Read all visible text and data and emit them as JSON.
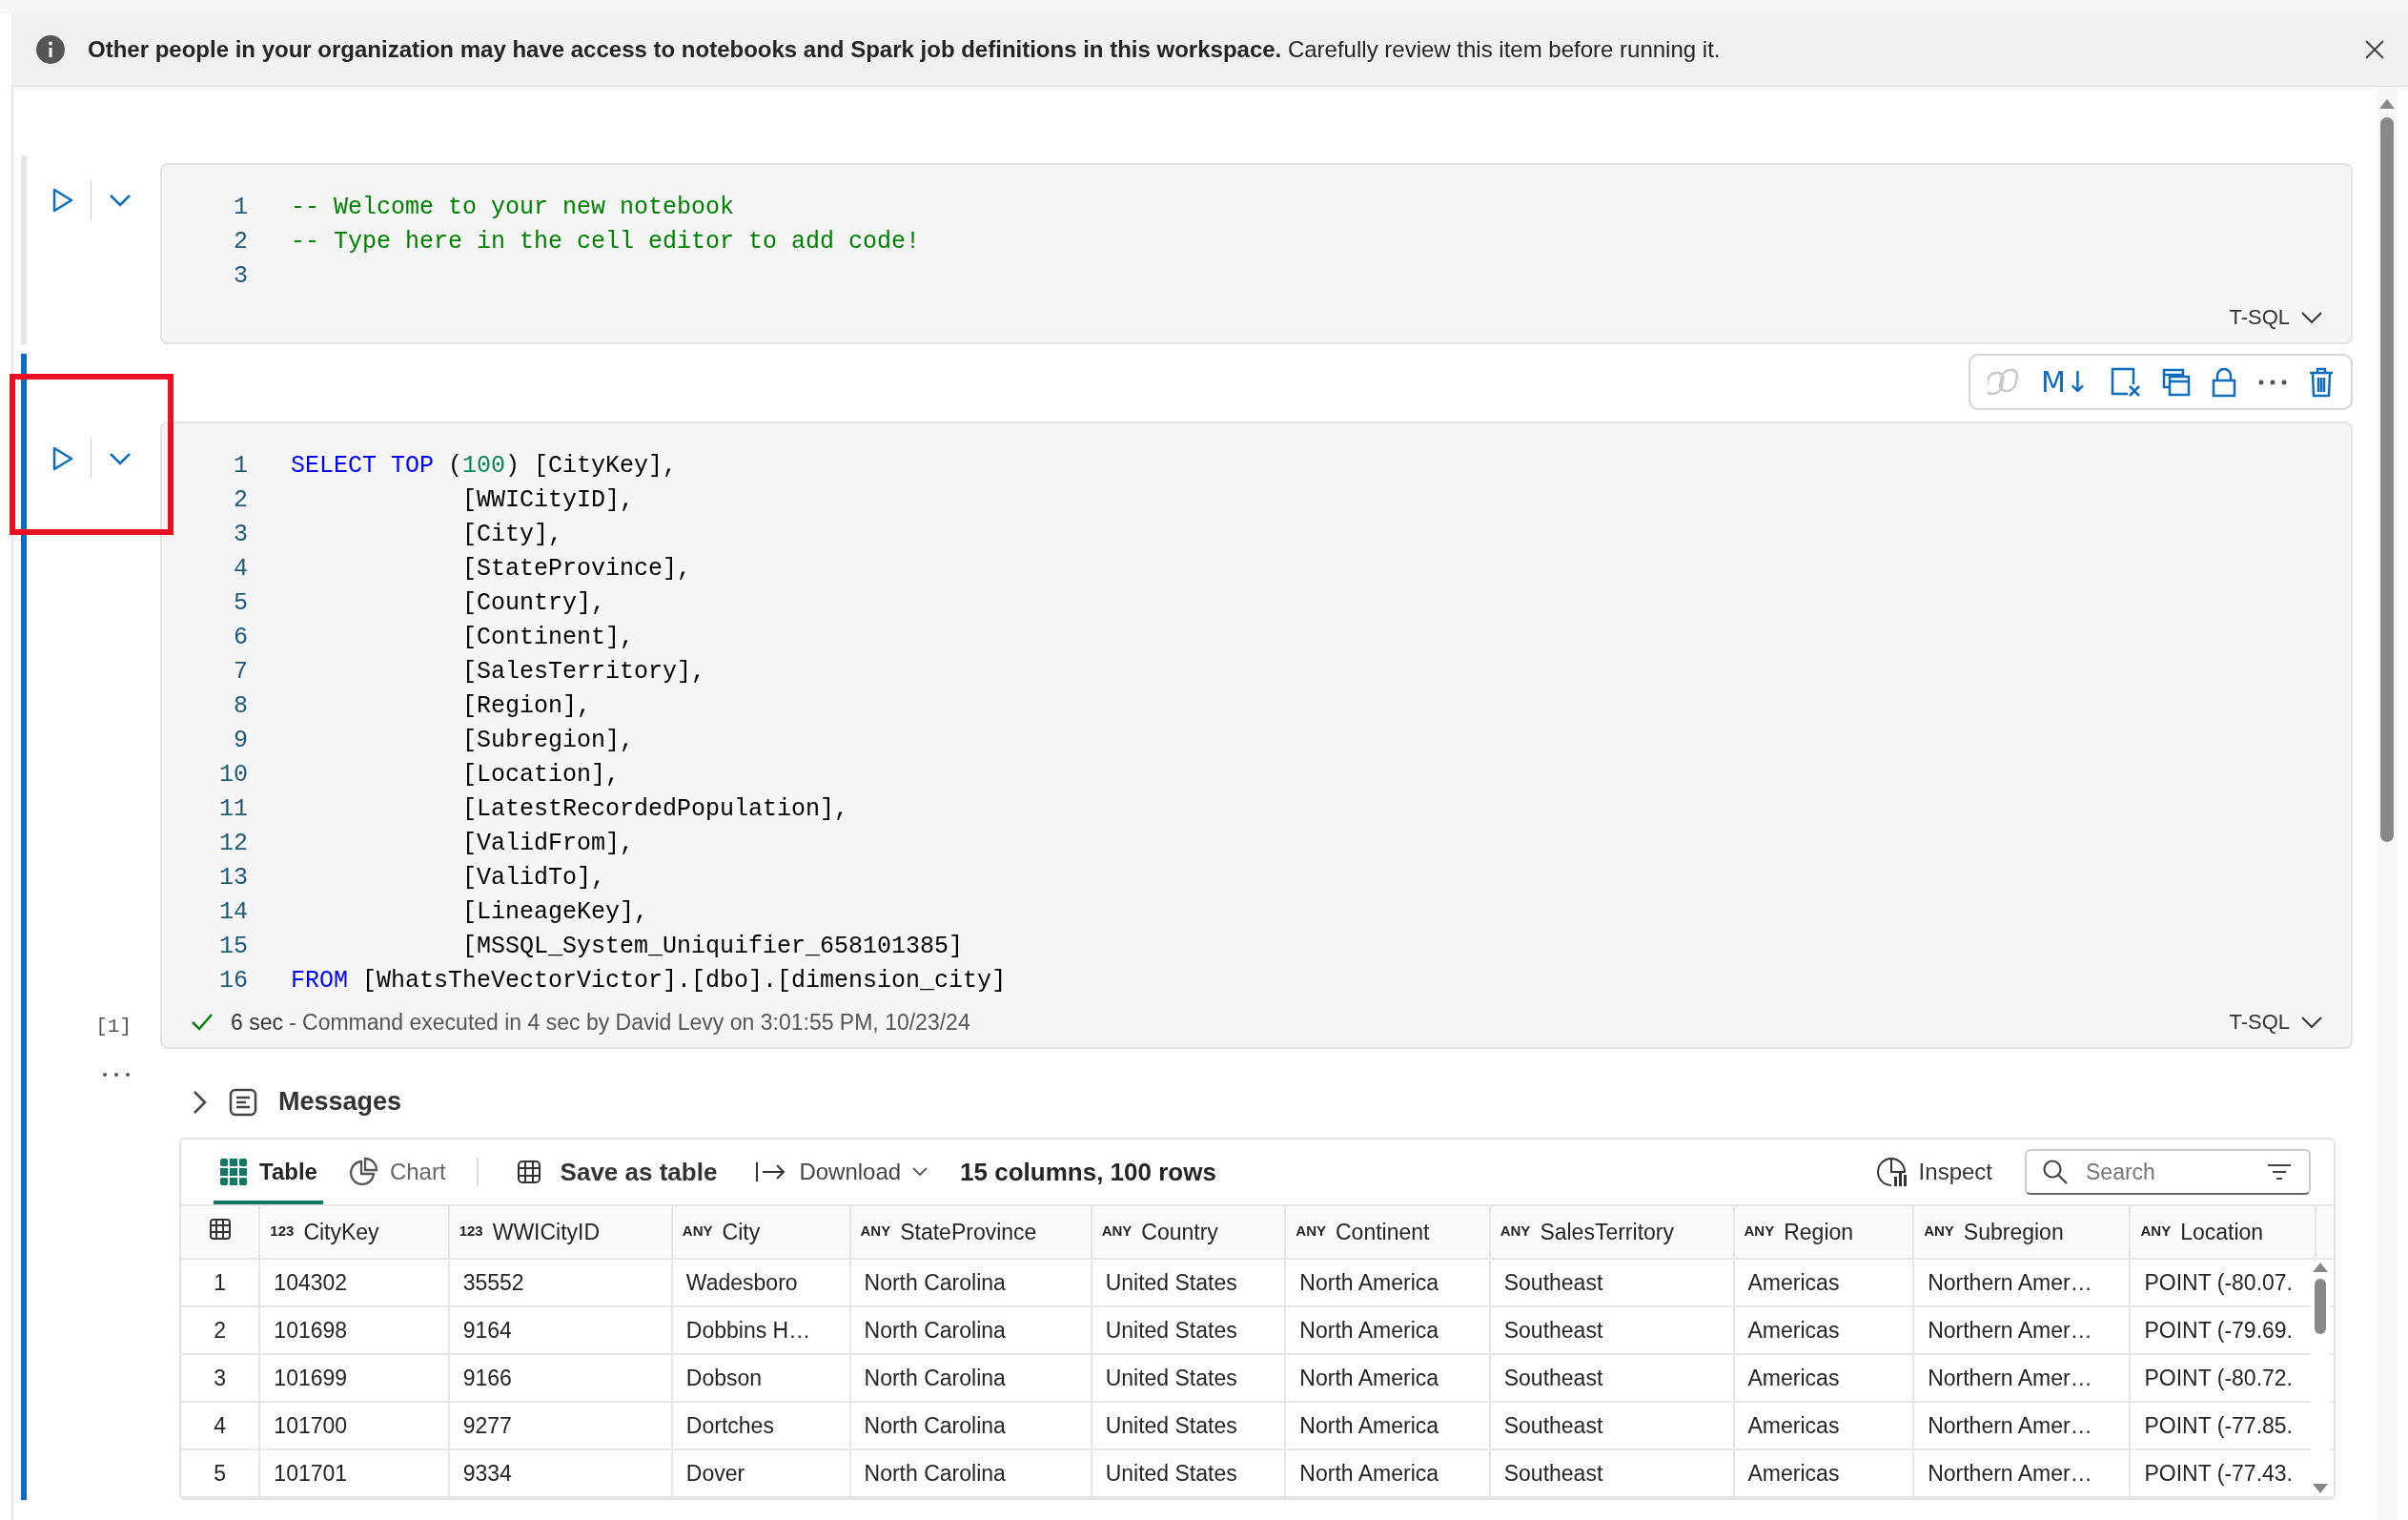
{
  "banner": {
    "bold_text": "Other people in your organization may have access to notebooks and Spark job definitions in this workspace.",
    "text": "Carefully review this item before running it."
  },
  "cells": [
    {
      "selected": false,
      "annotated": false,
      "language": "T-SQL",
      "lines": [
        {
          "number": "1",
          "tokens": [
            {
              "text": "-- Welcome to your new notebook",
              "kind": "comment"
            }
          ]
        },
        {
          "number": "2",
          "tokens": [
            {
              "text": "-- Type here in the cell editor to add code!",
              "kind": "comment"
            }
          ]
        },
        {
          "number": "3"
        }
      ]
    },
    {
      "selected": true,
      "annotated": true,
      "language": "T-SQL",
      "toolbar": {
        "copilot_enabled": false,
        "markdown_label": "M↓"
      },
      "lines": [
        {
          "number": "1",
          "tokens": [
            {
              "text": "SELECT",
              "kind": "keyword"
            },
            {
              "text": " TOP",
              "kind": "keyword"
            },
            {
              "text": " (",
              "kind": "plain"
            },
            {
              "text": "100",
              "kind": "number"
            },
            {
              "text": ") [CityKey],",
              "kind": "plain"
            }
          ]
        },
        {
          "number": "2",
          "tokens": [
            {
              "text": "            [WWICityID],",
              "kind": "plain"
            }
          ]
        },
        {
          "number": "3",
          "tokens": [
            {
              "text": "            [City],",
              "kind": "plain"
            }
          ]
        },
        {
          "number": "4",
          "tokens": [
            {
              "text": "            [StateProvince],",
              "kind": "plain"
            }
          ]
        },
        {
          "number": "5",
          "tokens": [
            {
              "text": "            [Country],",
              "kind": "plain"
            }
          ]
        },
        {
          "number": "6",
          "tokens": [
            {
              "text": "            [Continent],",
              "kind": "plain"
            }
          ]
        },
        {
          "number": "7",
          "tokens": [
            {
              "text": "            [SalesTerritory],",
              "kind": "plain"
            }
          ]
        },
        {
          "number": "8",
          "tokens": [
            {
              "text": "            [Region],",
              "kind": "plain"
            }
          ]
        },
        {
          "number": "9",
          "tokens": [
            {
              "text": "            [Subregion],",
              "kind": "plain"
            }
          ]
        },
        {
          "number": "10",
          "tokens": [
            {
              "text": "            [Location],",
              "kind": "plain"
            }
          ]
        },
        {
          "number": "11",
          "tokens": [
            {
              "text": "            [LatestRecordedPopulation],",
              "kind": "plain"
            }
          ]
        },
        {
          "number": "12",
          "tokens": [
            {
              "text": "            [ValidFrom],",
              "kind": "plain"
            }
          ]
        },
        {
          "number": "13",
          "tokens": [
            {
              "text": "            [ValidTo],",
              "kind": "plain"
            }
          ]
        },
        {
          "number": "14",
          "tokens": [
            {
              "text": "            [LineageKey],",
              "kind": "plain"
            }
          ]
        },
        {
          "number": "15",
          "tokens": [
            {
              "text": "            [MSSQL_System_Uniquifier_658101385]",
              "kind": "plain"
            }
          ]
        },
        {
          "number": "16",
          "tokens": [
            {
              "text": "FROM",
              "kind": "keyword"
            },
            {
              "text": " [WhatsTheVectorVictor].[dbo].[dimension_city]",
              "kind": "plain"
            }
          ]
        }
      ],
      "execution": {
        "count": "[1]",
        "duration": "6 sec",
        "message": "- Command executed in 4 sec by David Levy on 3:01:55 PM, 10/23/24"
      },
      "messages": {
        "label": "Messages",
        "expanded": false
      },
      "results": {
        "tabs": [
          {
            "label": "Table",
            "selected": true
          },
          {
            "label": "Chart",
            "selected": false
          }
        ],
        "save_label": "Save as table",
        "download_label": "Download",
        "summary": "15 columns, 100 rows",
        "inspect_label": "Inspect",
        "search": {
          "placeholder": "Search"
        },
        "columns": [
          {
            "type": "123",
            "name": "CityKey"
          },
          {
            "type": "123",
            "name": "WWICityID"
          },
          {
            "type": "ANY",
            "name": "City"
          },
          {
            "type": "ANY",
            "name": "StateProvince"
          },
          {
            "type": "ANY",
            "name": "Country"
          },
          {
            "type": "ANY",
            "name": "Continent"
          },
          {
            "type": "ANY",
            "name": "SalesTerritory"
          },
          {
            "type": "ANY",
            "name": "Region"
          },
          {
            "type": "ANY",
            "name": "Subregion"
          },
          {
            "type": "ANY",
            "name": "Location"
          }
        ],
        "rows": [
          {
            "index": "1",
            "cells": [
              "104302",
              "35552",
              "Wadesboro",
              "North Carolina",
              "United States",
              "North America",
              "Southeast",
              "Americas",
              "Northern Amer…",
              "POINT (-80.07."
            ]
          },
          {
            "index": "2",
            "cells": [
              "101698",
              "9164",
              "Dobbins H…",
              "North Carolina",
              "United States",
              "North America",
              "Southeast",
              "Americas",
              "Northern Amer…",
              "POINT (-79.69."
            ]
          },
          {
            "index": "3",
            "cells": [
              "101699",
              "9166",
              "Dobson",
              "North Carolina",
              "United States",
              "North America",
              "Southeast",
              "Americas",
              "Northern Amer…",
              "POINT (-80.72."
            ]
          },
          {
            "index": "4",
            "cells": [
              "101700",
              "9277",
              "Dortches",
              "North Carolina",
              "United States",
              "North America",
              "Southeast",
              "Americas",
              "Northern Amer…",
              "POINT (-77.85."
            ]
          },
          {
            "index": "5",
            "cells": [
              "101701",
              "9334",
              "Dover",
              "North Carolina",
              "United States",
              "North America",
              "Southeast",
              "Americas",
              "Northern Amer…",
              "POINT (-77.43."
            ]
          }
        ]
      }
    }
  ]
}
